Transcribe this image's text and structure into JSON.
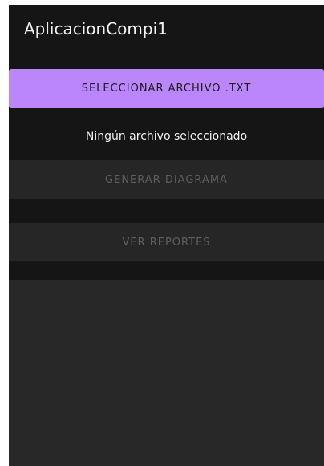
{
  "app": {
    "title": "AplicacionCompi1"
  },
  "actions": {
    "select_file_label": "SELECCIONAR ARCHIVO .TXT",
    "generate_diagram_label": "GENERAR DIAGRAMA",
    "view_reports_label": "VER REPORTES"
  },
  "status": {
    "file_status": "Ningún archivo seleccionado"
  },
  "colors": {
    "background": "#151515",
    "primary_button": "#bb86fc",
    "disabled_button": "#262626",
    "disabled_text": "#5f5f5f",
    "content_panel": "#282828"
  }
}
